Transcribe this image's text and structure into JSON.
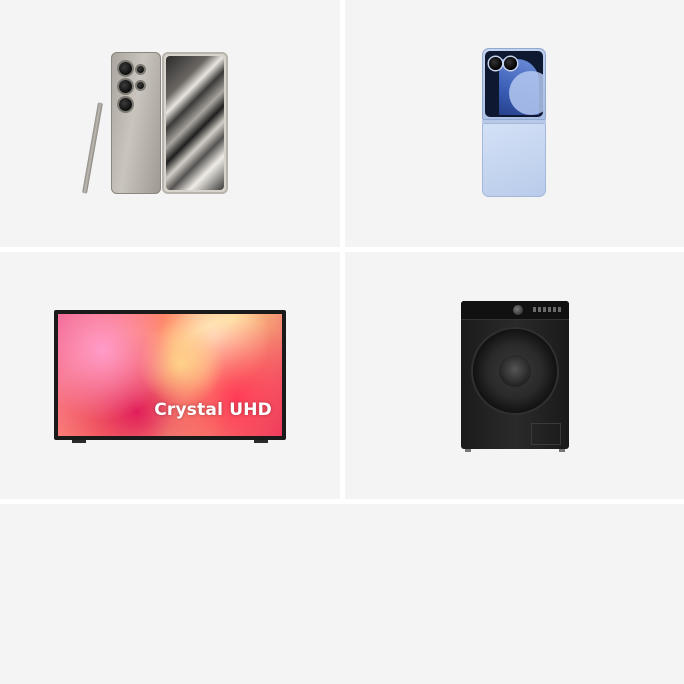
{
  "page": {
    "background": "#ffffff",
    "tile_background": "#f4f4f4"
  },
  "products": [
    {
      "name": "phone-with-stylus",
      "icon": "smartphone-icon",
      "colors": {
        "frame": "#a9a59e",
        "camera": "#111111"
      }
    },
    {
      "name": "flip-phone",
      "icon": "flip-phone-icon",
      "colors": {
        "body": "#c8d6ee",
        "cover_screen": "#3b5fb8"
      }
    },
    {
      "name": "television",
      "icon": "tv-icon",
      "screen_text": "Crystal UHD",
      "colors": {
        "frame": "#1a1a1a",
        "screen_accent": "#e53960"
      }
    },
    {
      "name": "washing-machine",
      "icon": "washer-icon",
      "colors": {
        "body": "#1b1b1b"
      }
    }
  ]
}
